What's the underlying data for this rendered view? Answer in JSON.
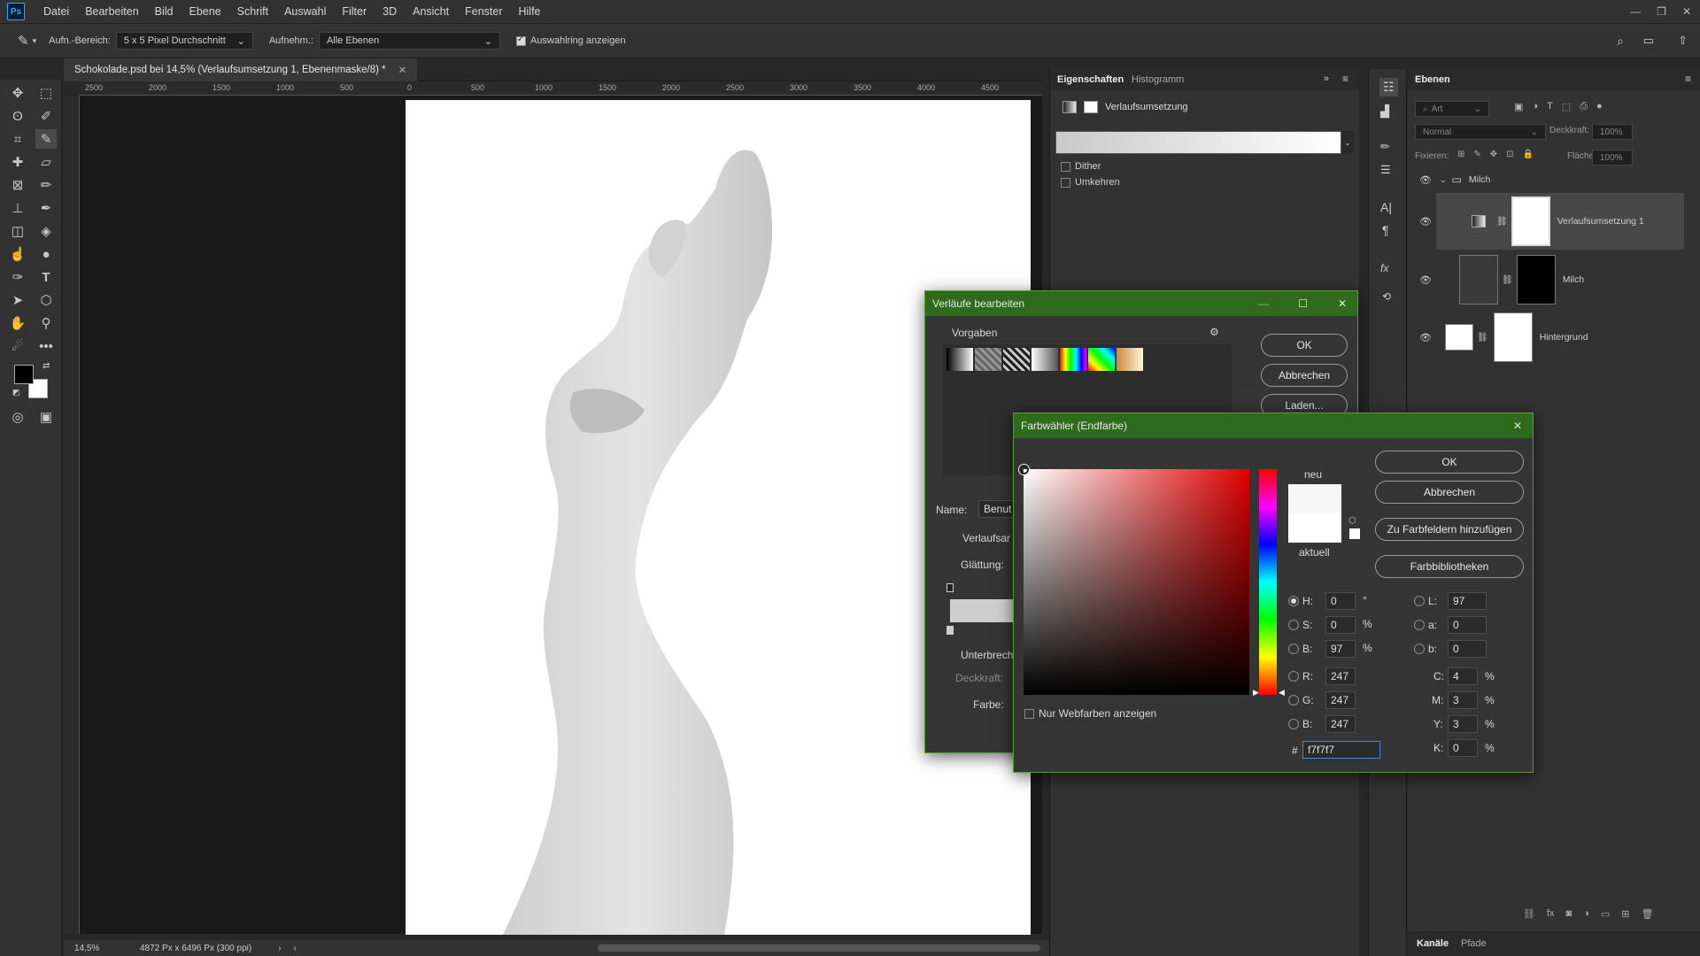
{
  "menubar": {
    "app_icon": "Ps",
    "items": [
      "Datei",
      "Bearbeiten",
      "Bild",
      "Ebene",
      "Schrift",
      "Auswahl",
      "Filter",
      "3D",
      "Ansicht",
      "Fenster",
      "Hilfe"
    ]
  },
  "options": {
    "sample_size_label": "Aufn.-Bereich:",
    "sample_size_value": "5 x 5 Pixel Durchschnitt",
    "sample_label": "Aufnehm.:",
    "sample_value": "Alle Ebenen",
    "show_ring_label": "Auswahlring anzeigen",
    "show_ring_checked": true
  },
  "document": {
    "tab_title": "Schokolade.psd bei 14,5% (Verlaufsumsetzung 1, Ebenenmaske/8) *",
    "ruler_ticks": [
      "2500",
      "2000",
      "1500",
      "1000",
      "500",
      "0",
      "500",
      "1000",
      "1500",
      "2000",
      "2500",
      "3000",
      "3500",
      "4000",
      "4500"
    ]
  },
  "status": {
    "zoom": "14,5%",
    "doc_info": "4872 Px x 6496 Px (300 ppi)"
  },
  "properties": {
    "tabs": [
      "Eigenschaften",
      "Histogramm"
    ],
    "title": "Verlaufsumsetzung",
    "dither_label": "Dither",
    "reverse_label": "Umkehren"
  },
  "layers": {
    "tab": "Ebenen",
    "filter_placeholder": "Art",
    "blend_mode": "Normal",
    "opacity_label": "Deckkraft:",
    "opacity_value": "100%",
    "lock_label": "Fixieren:",
    "fill_label": "Fläche:",
    "fill_value": "100%",
    "group_name": "Milch",
    "items": [
      {
        "name": "Verlaufsumsetzung 1"
      },
      {
        "name": "Milch"
      },
      {
        "name": "Hintergrund"
      }
    ],
    "bottom_tabs": [
      "Kanäle",
      "Pfade"
    ]
  },
  "gradient_editor": {
    "title": "Verläufe bearbeiten",
    "presets_label": "Vorgaben",
    "ok": "OK",
    "cancel": "Abbrechen",
    "load": "Laden...",
    "name_label": "Name:",
    "name_value": "Benut",
    "type_label": "Verlaufsar",
    "smooth_label": "Glättung:",
    "stops_label": "Unterbrech",
    "opacity_label": "Deckkraft:",
    "color_label": "Farbe:"
  },
  "color_picker": {
    "title": "Farbwähler (Endfarbe)",
    "new_label": "neu",
    "current_label": "aktuell",
    "ok": "OK",
    "cancel": "Abbrechen",
    "add_swatch": "Zu Farbfeldern hinzufügen",
    "libraries": "Farbbibliotheken",
    "web_only_label": "Nur Webfarben anzeigen",
    "H": "0",
    "S": "0",
    "B": "97",
    "R": "247",
    "G": "247",
    "Bv": "247",
    "L": "97",
    "a": "0",
    "b": "0",
    "C": "4",
    "M": "3",
    "Y": "3",
    "K": "0",
    "hex": "f7f7f7",
    "deg": "°",
    "pct": "%",
    "hash": "#"
  }
}
